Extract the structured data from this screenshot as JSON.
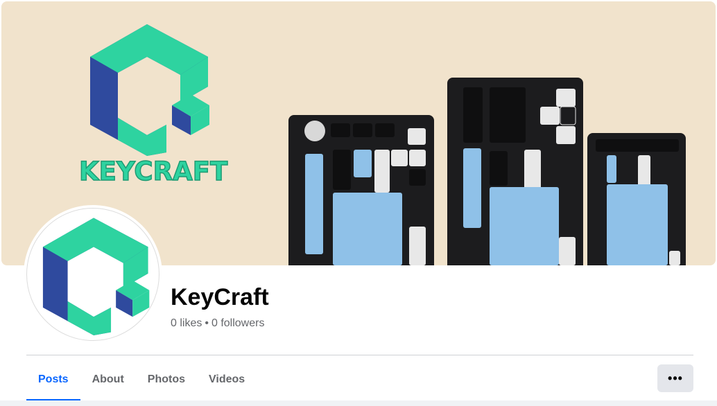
{
  "cover": {
    "brand_wordmark": "KEYCRAFT",
    "background_color": "#f1e3cc",
    "logo_colors": {
      "teal": "#2ed3a0",
      "navy": "#2f4a9e",
      "side": "#27a88c"
    }
  },
  "profile": {
    "name": "KeyCraft",
    "likes": "0 likes",
    "separator": "•",
    "followers": "0 followers"
  },
  "tabs": [
    {
      "label": "Posts",
      "active": true
    },
    {
      "label": "About",
      "active": false
    },
    {
      "label": "Photos",
      "active": false
    },
    {
      "label": "Videos",
      "active": false
    }
  ],
  "more_button": {
    "label": "•••"
  },
  "colors": {
    "accent": "#0866ff",
    "muted_text": "#65676b",
    "button_bg": "#e4e6eb"
  }
}
